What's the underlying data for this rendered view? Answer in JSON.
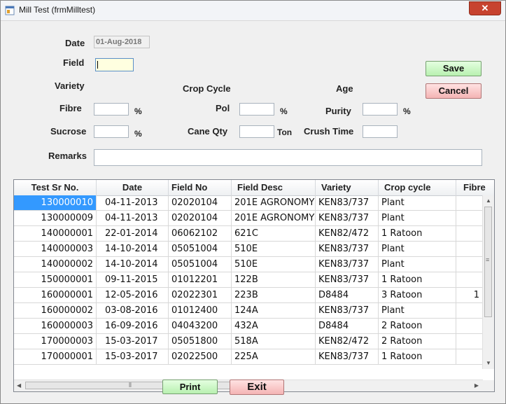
{
  "window": {
    "title": "Mill Test (frmMilltest)",
    "close_label": "✕"
  },
  "form": {
    "date_label": "Date",
    "date_value": "01-Aug-2018",
    "field_label": "Field",
    "variety_label": "Variety",
    "crop_cycle_label": "Crop Cycle",
    "age_label": "Age",
    "fibre_label": "Fibre",
    "pol_label": "Pol",
    "purity_label": "Purity",
    "sucrose_label": "Sucrose",
    "cane_qty_label": "Cane Qty",
    "crush_time_label": "Crush Time",
    "remarks_label": "Remarks",
    "percent_unit": "%",
    "ton_unit": "Ton"
  },
  "buttons": {
    "save": "Save",
    "cancel": "Cancel",
    "print": "Print",
    "exit": "Exit"
  },
  "grid": {
    "columns": [
      "Test Sr No.",
      "Date",
      "Field No",
      "Field Desc",
      "Variety",
      "Crop cycle",
      "Fibre"
    ],
    "rows": [
      [
        "130000010",
        "04-11-2013",
        "02020104",
        "201E AGRONOMY",
        "KEN83/737",
        "Plant",
        ""
      ],
      [
        "130000009",
        "04-11-2013",
        "02020104",
        "201E AGRONOMY",
        "KEN83/737",
        "Plant",
        ""
      ],
      [
        "140000001",
        "22-01-2014",
        "06062102",
        "621C",
        "KEN82/472",
        "1 Ratoon",
        ""
      ],
      [
        "140000003",
        "14-10-2014",
        "05051004",
        "510E",
        "KEN83/737",
        "Plant",
        ""
      ],
      [
        "140000002",
        "14-10-2014",
        "05051004",
        "510E",
        "KEN83/737",
        "Plant",
        ""
      ],
      [
        "150000001",
        "09-11-2015",
        "01012201",
        "122B",
        "KEN83/737",
        "1 Ratoon",
        ""
      ],
      [
        "160000001",
        "12-05-2016",
        "02022301",
        "223B",
        "D8484",
        "3 Ratoon",
        "1"
      ],
      [
        "160000002",
        "03-08-2016",
        "01012400",
        "124A",
        "KEN83/737",
        "Plant",
        ""
      ],
      [
        "160000003",
        "16-09-2016",
        "04043200",
        "432A",
        "D8484",
        "2 Ratoon",
        ""
      ],
      [
        "170000003",
        "15-03-2017",
        "05051800",
        "518A",
        "KEN82/472",
        "2 Ratoon",
        ""
      ],
      [
        "170000001",
        "15-03-2017",
        "02022500",
        "225A",
        "KEN83/737",
        "1 Ratoon",
        ""
      ]
    ],
    "selected_row": 0
  }
}
